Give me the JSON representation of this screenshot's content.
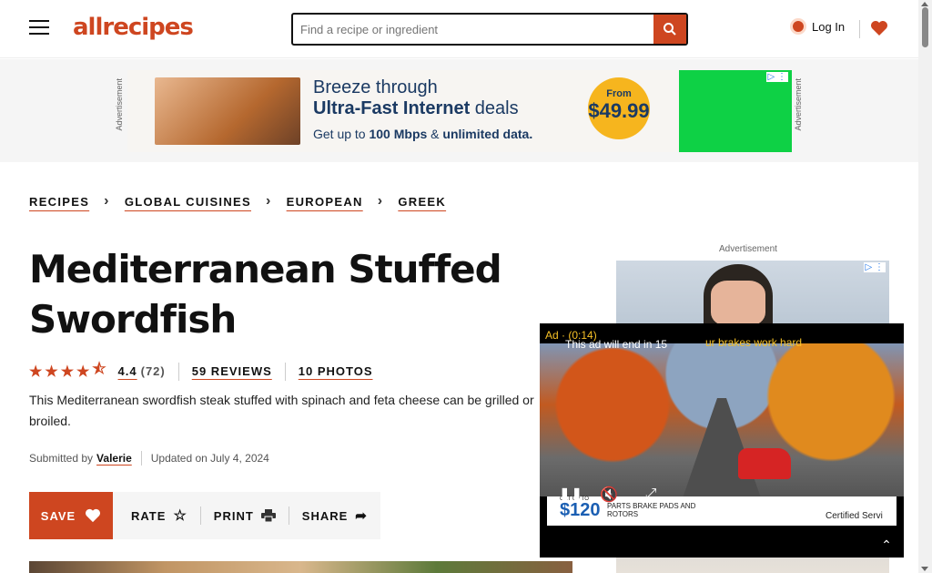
{
  "header": {
    "logo": "allrecipes",
    "search_placeholder": "Find a recipe or ingredient",
    "login": "Log In"
  },
  "top_ad": {
    "label": "Advertisement",
    "line1": "Breeze through",
    "line2_bold": "Ultra-Fast Internet",
    "line2_rest": " deals",
    "line3_pre": "Get up to ",
    "line3_b1": "100 Mbps",
    "line3_mid": " & ",
    "line3_b2": "unlimited data.",
    "price_from": "From",
    "price": "$49.99"
  },
  "breadcrumb": [
    "RECIPES",
    "GLOBAL CUISINES",
    "EUROPEAN",
    "GREEK"
  ],
  "recipe": {
    "title": "Mediterranean Stuffed Swordfish",
    "rating": "4.4",
    "rating_count": "(72)",
    "reviews": "59 REVIEWS",
    "photos": "10 PHOTOS",
    "description": "This Mediterranean swordfish steak stuffed with spinach and feta cheese can be grilled or broiled.",
    "submitted_by_label": "Submitted by",
    "author": "Valerie",
    "updated": "Updated on July 4, 2024"
  },
  "actions": {
    "save": "SAVE",
    "rate": "RATE",
    "print": "PRINT",
    "share": "SHARE"
  },
  "right_ad": {
    "label": "Advertisement"
  },
  "video_ad": {
    "ad_time": "Ad · (0:14)",
    "end_msg": "This ad will end in 15",
    "headline": "ur brakes work hard",
    "promo_price": "$120",
    "promo_up_to": "GET UP TO",
    "promo_text": "PARTS BRAKE PADS AND ROTORS",
    "certified": "Certified Servi"
  }
}
